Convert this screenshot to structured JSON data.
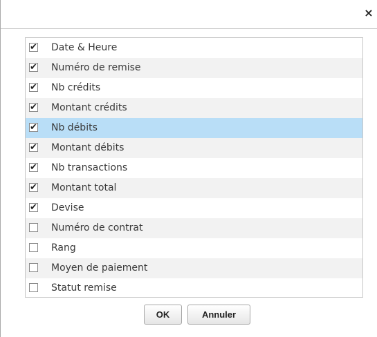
{
  "dialog": {
    "close_glyph": "×"
  },
  "columns": [
    {
      "label": "Date & Heure",
      "checked": true
    },
    {
      "label": "Numéro de remise",
      "checked": true
    },
    {
      "label": "Nb crédits",
      "checked": true
    },
    {
      "label": "Montant crédits",
      "checked": true
    },
    {
      "label": "Nb débits",
      "checked": true,
      "selected": true
    },
    {
      "label": "Montant débits",
      "checked": true
    },
    {
      "label": "Nb transactions",
      "checked": true
    },
    {
      "label": "Montant total",
      "checked": true
    },
    {
      "label": "Devise",
      "checked": true
    },
    {
      "label": "Numéro de contrat",
      "checked": false
    },
    {
      "label": "Rang",
      "checked": false
    },
    {
      "label": "Moyen de paiement",
      "checked": false
    },
    {
      "label": "Statut remise",
      "checked": false
    }
  ],
  "buttons": {
    "ok_label": "OK",
    "cancel_label": "Annuler"
  },
  "check_glyph": "✔",
  "colors": {
    "selected_row": "#b9def7",
    "alt_row": "#f2f2f2"
  }
}
